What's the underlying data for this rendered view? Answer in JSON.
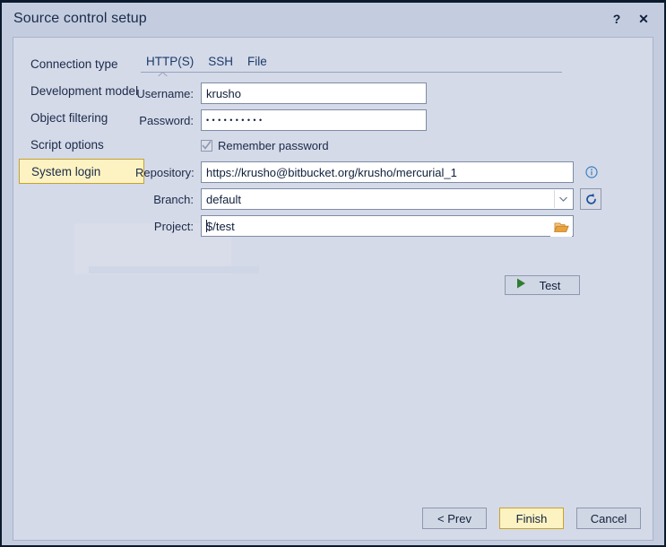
{
  "window": {
    "title": "Source control setup",
    "help_label": "?",
    "close_label": "✕"
  },
  "nav": {
    "items": [
      {
        "label": "Connection type",
        "selected": false
      },
      {
        "label": "Development model",
        "selected": false
      },
      {
        "label": "Object filtering",
        "selected": false
      },
      {
        "label": "Script options",
        "selected": false
      },
      {
        "label": "System login",
        "selected": true
      }
    ]
  },
  "tabs": [
    {
      "label": "HTTP(S)",
      "active": true
    },
    {
      "label": "SSH",
      "active": false
    },
    {
      "label": "File",
      "active": false
    }
  ],
  "form": {
    "username": {
      "label": "Username:",
      "value": "krusho",
      "placeholder": ""
    },
    "password": {
      "label": "Password:",
      "value": "••••••••••",
      "placeholder": "",
      "dots": 10
    },
    "remember": {
      "label": "Remember password",
      "checked": true
    },
    "repository": {
      "label": "Repository:",
      "value": "https://krusho@bitbucket.org/krusho/mercurial_1",
      "placeholder": ""
    },
    "branch": {
      "label": "Branch:",
      "value": "default",
      "options": [
        "default"
      ]
    },
    "project": {
      "label": "Project:",
      "value": "$/test",
      "placeholder": ""
    },
    "info_icon": "info-icon",
    "refresh_icon": "refresh-icon",
    "browse_icon": "folder-icon"
  },
  "test_button": {
    "label": "Test",
    "icon": "play-icon"
  },
  "footer": {
    "prev": "< Prev",
    "finish": "Finish",
    "cancel": "Cancel"
  },
  "colors": {
    "window_bg": "#c4cde0",
    "panel_bg": "#d4dae8",
    "accent_yellow": "#fdf3c2",
    "accent_yellow_border": "#c8a22c",
    "text": "#1b2a49",
    "tab_text": "#1b3a6b",
    "play_green": "#2f7d32",
    "folder_orange": "#e8a33d",
    "info_blue": "#3f7fbf",
    "refresh_blue": "#1c4f9c"
  }
}
